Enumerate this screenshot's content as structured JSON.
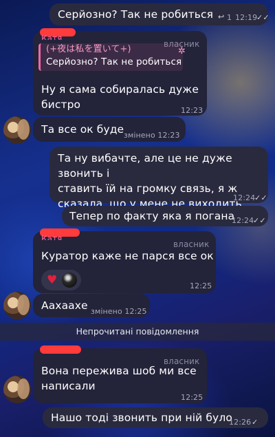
{
  "messages": [
    {
      "id": "m1",
      "text": "Серйозно? Так не робиться",
      "reply_count": "1",
      "time": "12:19",
      "status": "✓✓"
    },
    {
      "id": "m2",
      "owner": "власник",
      "quote_name": "(+夜は私を置いて+)",
      "quote_text": "Серйозно? Так не робиться",
      "line1": "Ну я сама собиралась дуже",
      "line2": "бистро",
      "time": "12:23"
    },
    {
      "id": "m3",
      "text": "Та все ок буде",
      "edited": "змінено 12:23"
    },
    {
      "id": "m4",
      "line1": "Та ну вибачте, але це не дуже звонить і",
      "line2": "ставить їй на громку связь, я ж",
      "line3": "сказала, що у мене не виходить",
      "time": "12:24",
      "status": "✓✓"
    },
    {
      "id": "m5",
      "text": "Тепер по факту яка я погана",
      "time": "12:24",
      "status": "✓✓"
    },
    {
      "id": "m6",
      "owner": "власник",
      "text": "Куратор каже не парся все ок",
      "time": "12:25",
      "reactions": [
        "heart",
        "8-ball"
      ]
    },
    {
      "id": "m7",
      "text": "Аахаахе",
      "edited": "змінено 12:25"
    },
    {
      "id": "m8",
      "owner": "власник",
      "line1": "Вона пережива шоб ми  все",
      "line2": "написали",
      "time": "12:25"
    },
    {
      "id": "m9",
      "text": "Нашо тоді звонить при ній було",
      "time": "12:26",
      "status": "✓"
    }
  ],
  "separator": "Непрочитані повідомлення",
  "partial_name_1": "Катя",
  "partial_name_2": "Катя",
  "colors": {
    "accent_pink": "#f36aa8",
    "redaction": "#ff3b3b",
    "bubble": "#2a2a3f"
  }
}
